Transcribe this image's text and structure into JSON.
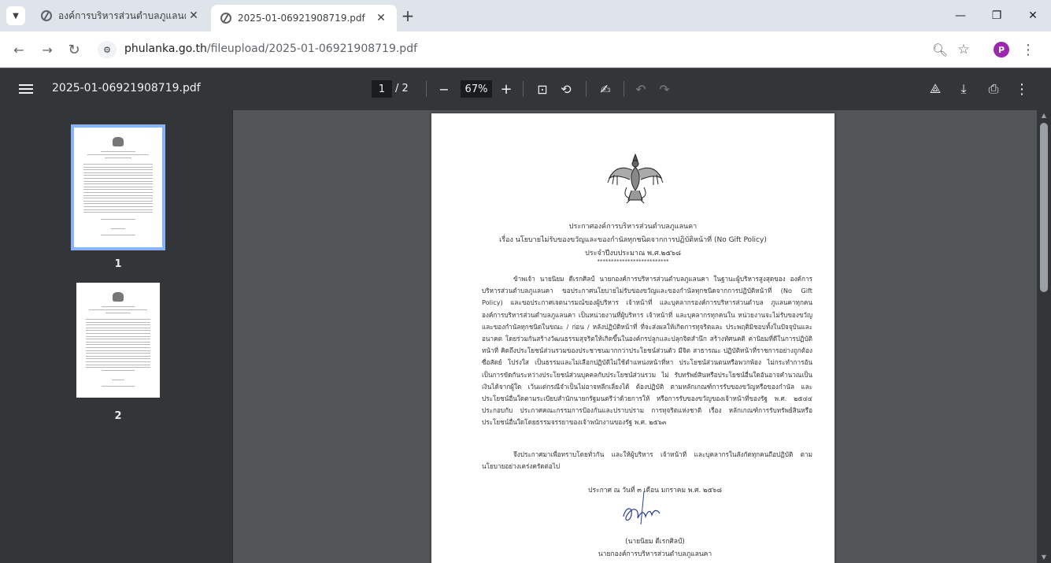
{
  "tabs": [
    {
      "title": "องค์การบริหารส่วนตำบลภูแลนคา อำเ",
      "active": false
    },
    {
      "title": "2025-01-06921908719.pdf",
      "active": true
    }
  ],
  "address": {
    "host": "phulanka.go.th",
    "path": "/fileupload/2025-01-06921908719.pdf"
  },
  "profile_initial": "P",
  "pdf_toolbar": {
    "title": "2025-01-06921908719.pdf",
    "current_page": "1",
    "total_pages": "/ 2",
    "zoom": "67%"
  },
  "thumbnails": [
    {
      "label": "1",
      "selected": true
    },
    {
      "label": "2",
      "selected": false
    }
  ],
  "document": {
    "heading1": "ประกาศองค์การบริหารส่วนตำบลภูแลนคา",
    "heading2": "เรื่อง นโยบายไม่รับของขวัญและของกำนัลทุกชนิดจากการปฏิบัติหน้าที่ (No Gift Policy)",
    "heading3": "ประจำปีงบประมาณ พ.ศ.๒๕๖๘",
    "stars": "**************************",
    "body": "ข้าพเจ้า นายนิยม ดีเรกศิลป์ นายกองค์การบริหารส่วนตำบลภูแลนคา ในฐานะผู้บริหารสูงสุดของ องค์การบริหารส่วนตำบลภูแลนคา ขอประกาศนโยบายไม่รับของขวัญและของกำนัลทุกชนิดจากการปฏิบัติหน้าที่ (No Gift Policy) และขอประกาศเจตนารมณ์ของผู้บริหาร เจ้าหน้าที่ และบุคลากรองค์การบริหารส่วนตำบล ภูแลนคาทุกคนองค์การบริหารส่วนตำบลภูแลนคา เป็นหน่วยงานที่ผู้บริหาร เจ้าหน้าที่ และบุคลากรทุกคนใน หน่วยงานจะไม่รับของขวัญและของกำนัลทุกชนิดในขณะ / ก่อน / หลังปฏิบัติหน้าที่ ที่จะส่งผลให้เกิดการทุจริตและ ประพฤติมิชอบทั้งในปัจจุบันและอนาคต โดยร่วมกันสร้างวัฒนธรรมสุจริตให้เกิดขึ้นในองค์กรปลูกและปลุกจิตสำนึก สร้างทัศนคติ ค่านิยมที่ดีในการปฏิบัติหน้าที่ คิดถึงประโยชน์ส่วนรวมของประชาชนมากกว่าประโยชน์ส่วนตัว มีจิต สาธารณะ ปฏิบัติหน้าที่ราชการอย่างถูกต้อง ซื่อสัตย์ โปร่งใส เป็นธรรมและไม่เลือกปฏิบัติไม่ใช้ตำแหน่งหน้าที่หา ประโยชน์ส่วนตนหรือพวกพ้อง ไม่กระทำการอันเป็นการขัดกันระหว่างประโยชน์ส่วนบุคคลกับประโยชน์ส่วนรวม ไม่ รับทรัพย์สินหรือประโยชน์อื่นใดอันอาจคำนวณเป็นเงินได้จากผู้ใด เว้นแต่กรณีจำเป็นไม่อาจหลีกเลี่ยงได้ ต้องปฏิบัติ ตามหลักเกณฑ์การรับของขวัญหรือของกำนัล และประโยชน์อื่นใดตามระเบียบสำนักนายกรัฐมนตรีว่าด้วยการให้ หรือการรับของขวัญของเจ้าหน้าที่ของรัฐ พ.ศ. ๒๕๔๔ ประกอบกับ ประกาศคณะกรรมการป้องกันและปราบปราม การทุจริตแห่งชาติ เรื่อง หลักเกณฑ์การรับทรัพย์สินหรือประโยชน์อื่นใดโดยธรรมจรรยาของเจ้าพนักงานของรัฐ พ.ศ. ๒๕๖๓",
    "closing": "จึงประกาศมาเพื่อทราบโดยทั่วกัน และให้ผู้บริหาร เจ้าหน้าที่ และบุคลากรในสังกัดทุกคนถือปฏิบัติ ตามนโยบายอย่างเคร่งครัดต่อไป",
    "date": "ประกาศ ณ วันที่ ๓ เดือน มกราคม พ.ศ. ๒๕๖๘",
    "signer_name": "(นายนิยม ดีเรกศิลป์)",
    "signer_title": "นายกองค์การบริหารส่วนตำบลภูแลนคา"
  },
  "colors": {
    "tabstrip": "#dfe3ea",
    "pdf_toolbar": "#323639",
    "viewer_bg": "#525659",
    "thumb_selection": "#8ab4f8",
    "profile": "#9c27b0"
  }
}
